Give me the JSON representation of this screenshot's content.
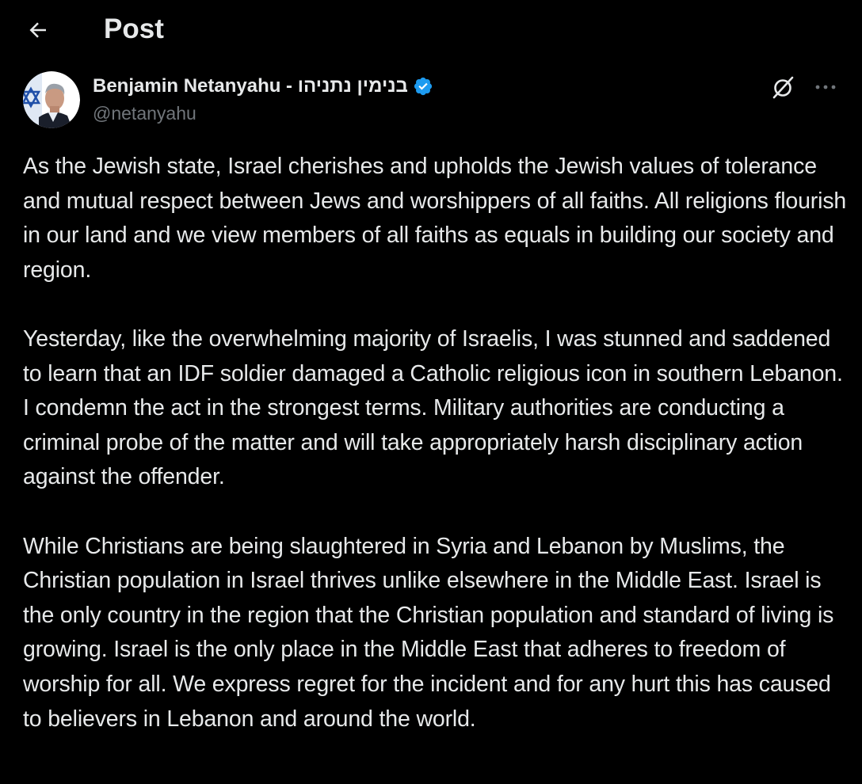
{
  "header": {
    "title": "Post",
    "back_icon": "arrow-left-icon"
  },
  "author": {
    "display_name": "Benjamin Netanyahu - בנימין נתניהו",
    "handle": "@netanyahu",
    "verified_icon": "verified-badge-icon",
    "verified_color": "#1d9bf0",
    "avatar_icon": "user-avatar"
  },
  "actions": {
    "grok_icon": "grok-icon",
    "more_icon": "more-horizontal-icon"
  },
  "post": {
    "paragraphs": [
      "As the Jewish state, Israel cherishes and upholds the Jewish values of tolerance and mutual respect between Jews and worshippers of all faiths. All religions flourish in our land and we view members of all faiths as equals in building our society and region.",
      "Yesterday, like the overwhelming majority of Israelis, I was stunned and saddened to learn that an IDF soldier damaged a Catholic religious icon in southern Lebanon. I condemn the act in the strongest terms. Military authorities are conducting a criminal probe of the matter and will take appropriately harsh disciplinary action against the offender.",
      "While Christians are being slaughtered in Syria and Lebanon by Muslims, the Christian population in Israel thrives unlike elsewhere in the Middle East. Israel is the only country in the region that the Christian population and standard of living is growing. Israel is the only place in the Middle East that adheres to freedom of worship for all. We express regret for the incident and for any hurt this has caused to believers in Lebanon and around the world."
    ]
  },
  "colors": {
    "background": "#000000",
    "text_primary": "#e7e9ea",
    "text_secondary": "#71767b",
    "accent": "#1d9bf0"
  }
}
